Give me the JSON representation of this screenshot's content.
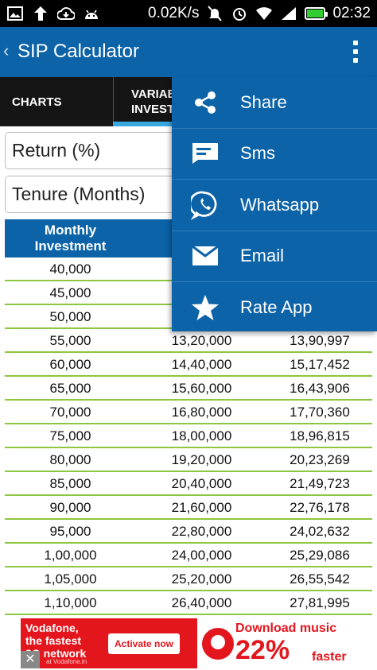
{
  "status_bar": {
    "speed": "0.02K/s",
    "time": "02:32",
    "battery_color": "#33cc33"
  },
  "app_bar": {
    "back_icon": "chevron-left-icon",
    "title": "SIP Calculator",
    "menu_icon": "overflow-menu-icon"
  },
  "tabs": [
    {
      "label": "CHARTS",
      "active": false
    },
    {
      "label_line1": "VARIAB",
      "label_line2": "INVEST",
      "active": true
    }
  ],
  "inputs": {
    "return_placeholder": "Return (%)",
    "tenure_placeholder": "Tenure (Months)"
  },
  "table": {
    "header_col1_line1": "Monthly",
    "header_col1_line2": "Investment",
    "rows": [
      [
        "40,000",
        "",
        ""
      ],
      [
        "45,000",
        "",
        ""
      ],
      [
        "50,000",
        "",
        ""
      ],
      [
        "55,000",
        "13,20,000",
        "13,90,997"
      ],
      [
        "60,000",
        "14,40,000",
        "15,17,452"
      ],
      [
        "65,000",
        "15,60,000",
        "16,43,906"
      ],
      [
        "70,000",
        "16,80,000",
        "17,70,360"
      ],
      [
        "75,000",
        "18,00,000",
        "18,96,815"
      ],
      [
        "80,000",
        "19,20,000",
        "20,23,269"
      ],
      [
        "85,000",
        "20,40,000",
        "21,49,723"
      ],
      [
        "90,000",
        "21,60,000",
        "22,76,178"
      ],
      [
        "95,000",
        "22,80,000",
        "24,02,632"
      ],
      [
        "1,00,000",
        "24,00,000",
        "25,29,086"
      ],
      [
        "1,05,000",
        "25,20,000",
        "26,55,542"
      ],
      [
        "1,10,000",
        "26,40,000",
        "27,81,995"
      ]
    ]
  },
  "menu": {
    "items": [
      {
        "label": "Share",
        "icon": "share-icon"
      },
      {
        "label": "Sms",
        "icon": "sms-icon"
      },
      {
        "label": "Whatsapp",
        "icon": "whatsapp-icon"
      },
      {
        "label": "Email",
        "icon": "email-icon"
      },
      {
        "label": "Rate App",
        "icon": "star-icon"
      }
    ]
  },
  "ad": {
    "line1": "Vodafone,",
    "line2": "the fastest",
    "line3": "3G network",
    "fine_print": "at Vodafone.in",
    "button": "Activate now",
    "download": "Download music",
    "percent": "22%",
    "faster": "faster",
    "close": "✕"
  },
  "colors": {
    "primary": "#0c63a8",
    "tab_indicator": "#39a7e0",
    "row_divider": "#8dc63f",
    "ad_red": "#e3161d"
  }
}
